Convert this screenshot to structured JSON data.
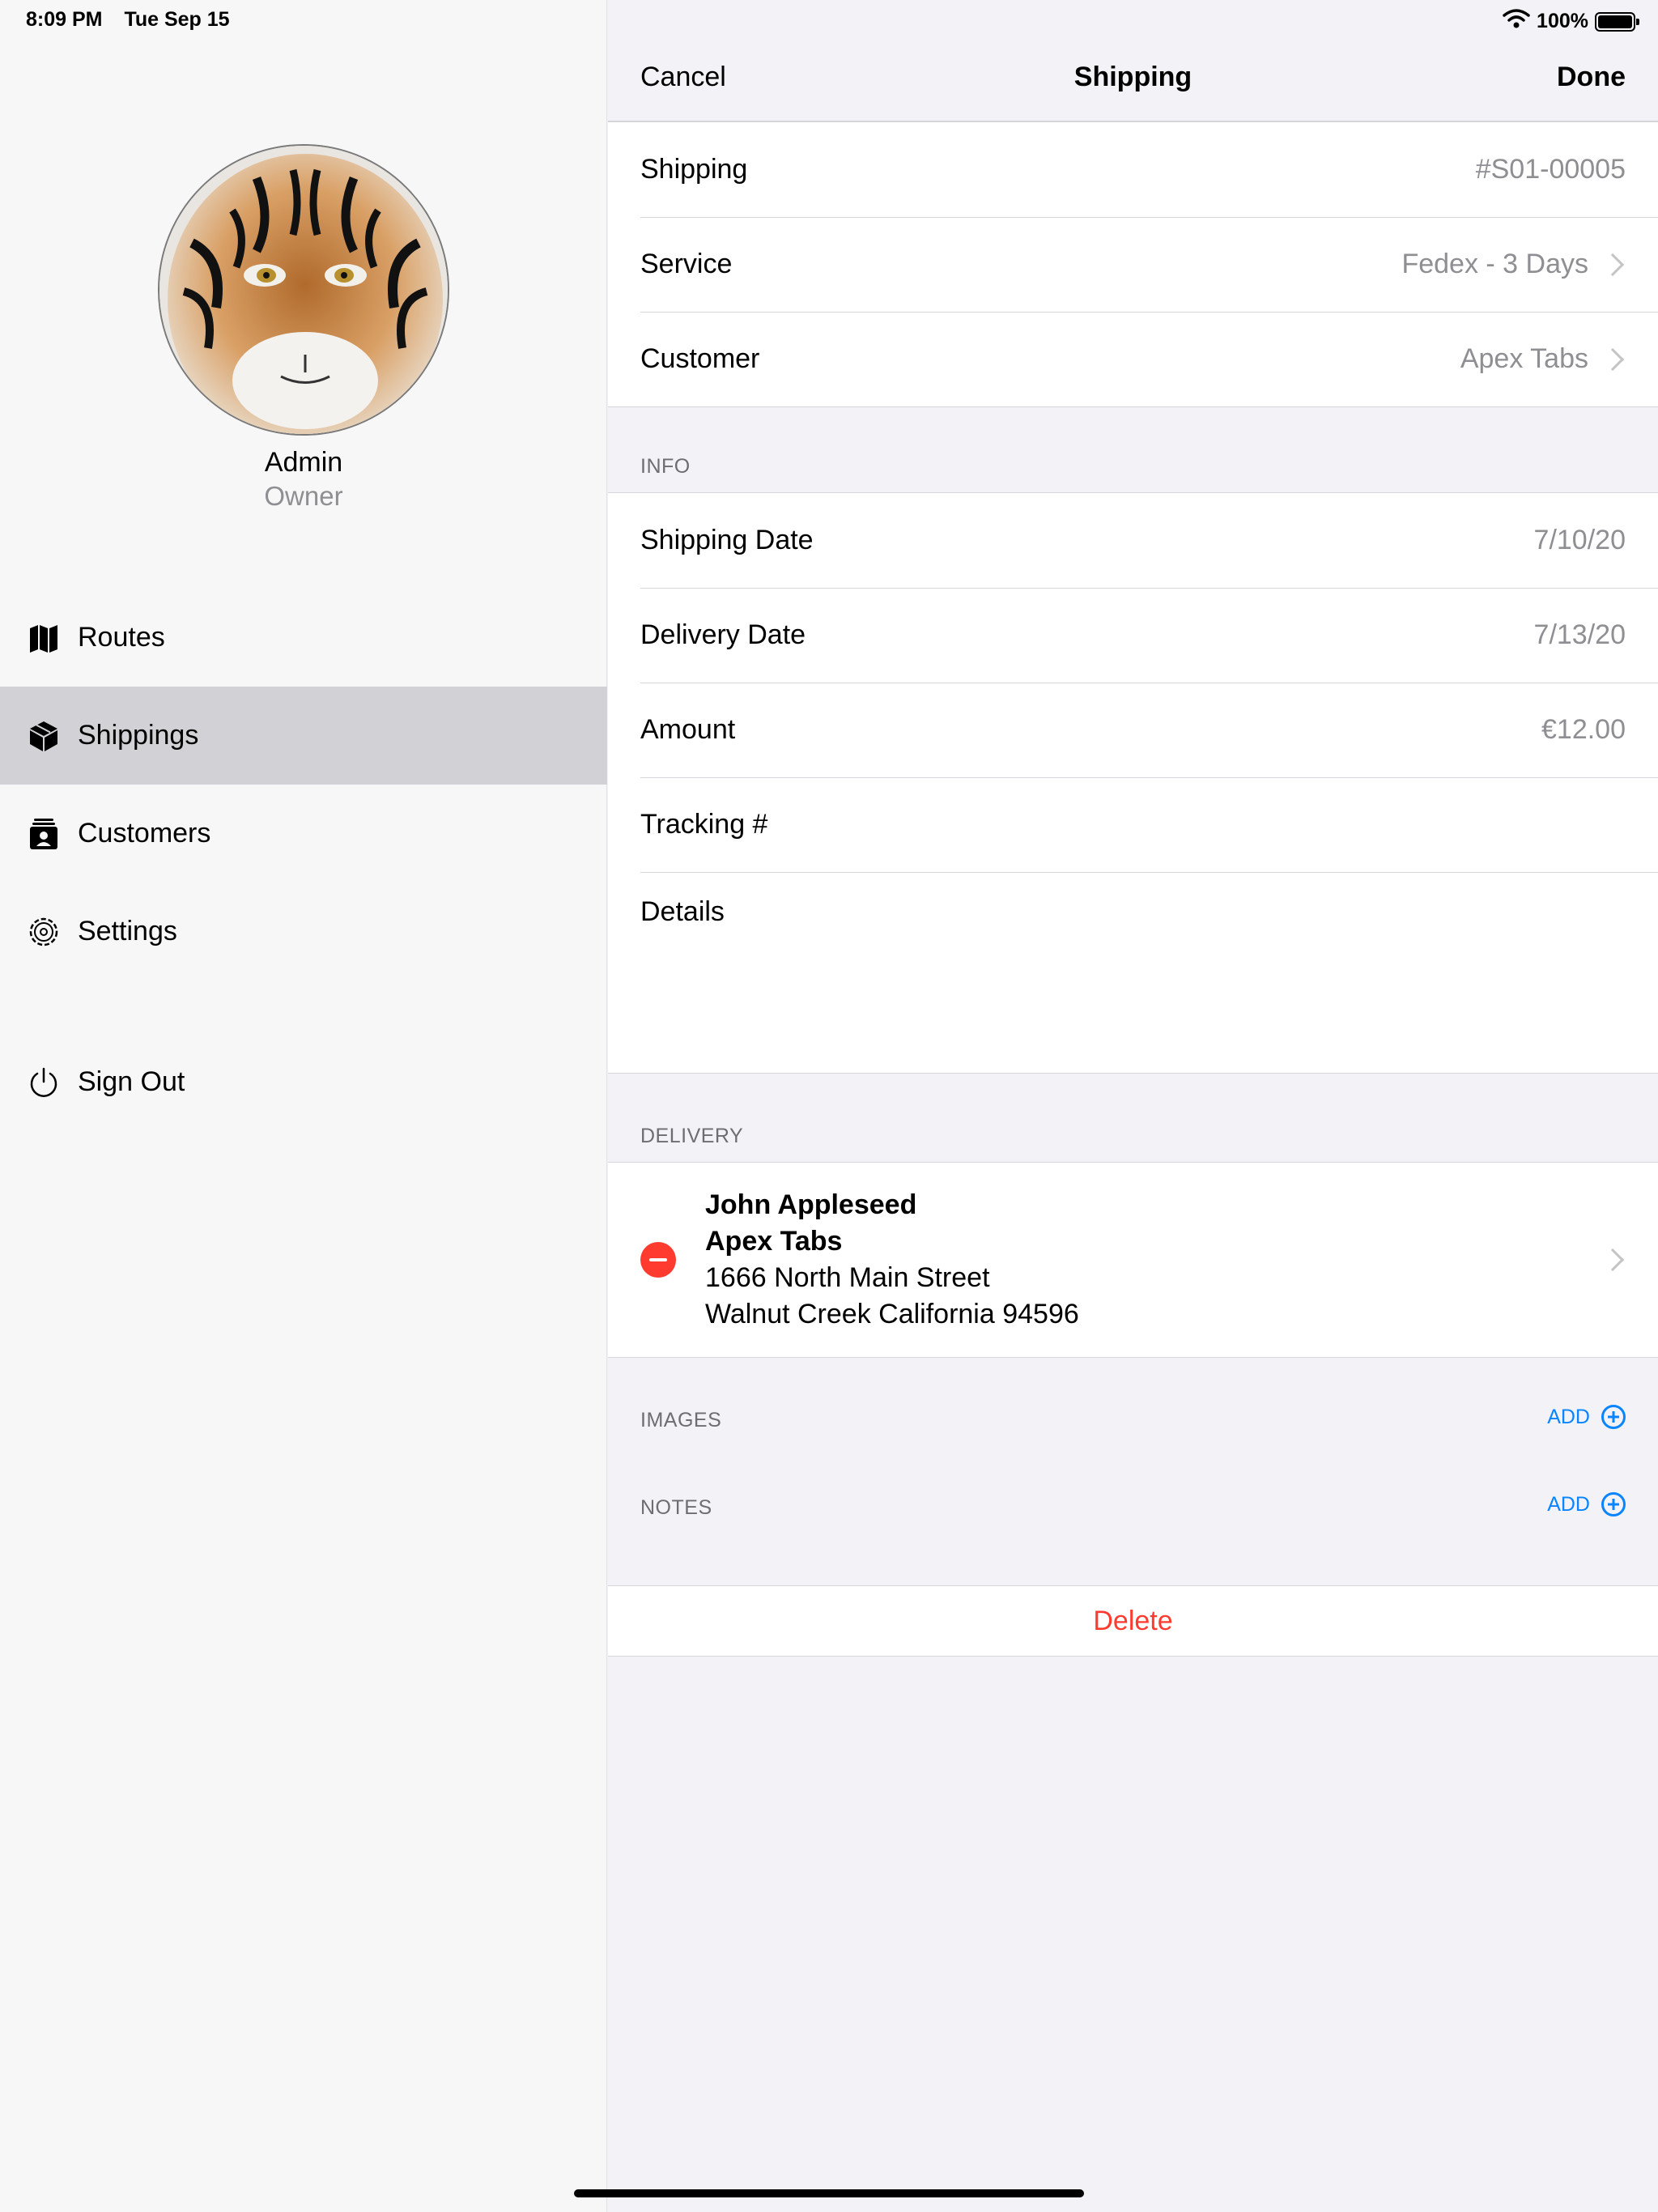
{
  "status_bar": {
    "time": "8:09 PM",
    "date": "Tue Sep 15",
    "battery": "100%"
  },
  "sidebar": {
    "profile": {
      "name": "Admin",
      "role": "Owner"
    },
    "items": [
      {
        "label": "Routes",
        "icon": "map-icon"
      },
      {
        "label": "Shippings",
        "icon": "box-icon",
        "selected": true
      },
      {
        "label": "Customers",
        "icon": "contact-card-icon"
      },
      {
        "label": "Settings",
        "icon": "gear-icon"
      },
      {
        "label": "Sign Out",
        "icon": "power-icon"
      }
    ]
  },
  "navbar": {
    "cancel": "Cancel",
    "title": "Shipping",
    "done": "Done"
  },
  "summary": [
    {
      "label": "Shipping",
      "value": "#S01-00005"
    },
    {
      "label": "Service",
      "value": "Fedex - 3 Days"
    },
    {
      "label": "Customer",
      "value": "Apex Tabs"
    }
  ],
  "info": {
    "header": "INFO",
    "rows": [
      {
        "label": "Shipping Date",
        "value": "7/10/20"
      },
      {
        "label": "Delivery Date",
        "value": "7/13/20"
      },
      {
        "label": "Amount",
        "value": "€12.00"
      },
      {
        "label": "Tracking #",
        "value": ""
      },
      {
        "label": "Details",
        "value": ""
      }
    ]
  },
  "delivery": {
    "header": "DELIVERY",
    "name": "John Appleseed",
    "company": "Apex Tabs",
    "street": "1666 North Main Street",
    "city": "Walnut Creek California 94596"
  },
  "images": {
    "header": "IMAGES",
    "add": "ADD"
  },
  "notes": {
    "header": "NOTES",
    "add": "ADD"
  },
  "delete_label": "Delete",
  "colors": {
    "accent": "#0a84ff",
    "destructive": "#ff3b30",
    "selected_bg": "#d1d1d6"
  }
}
